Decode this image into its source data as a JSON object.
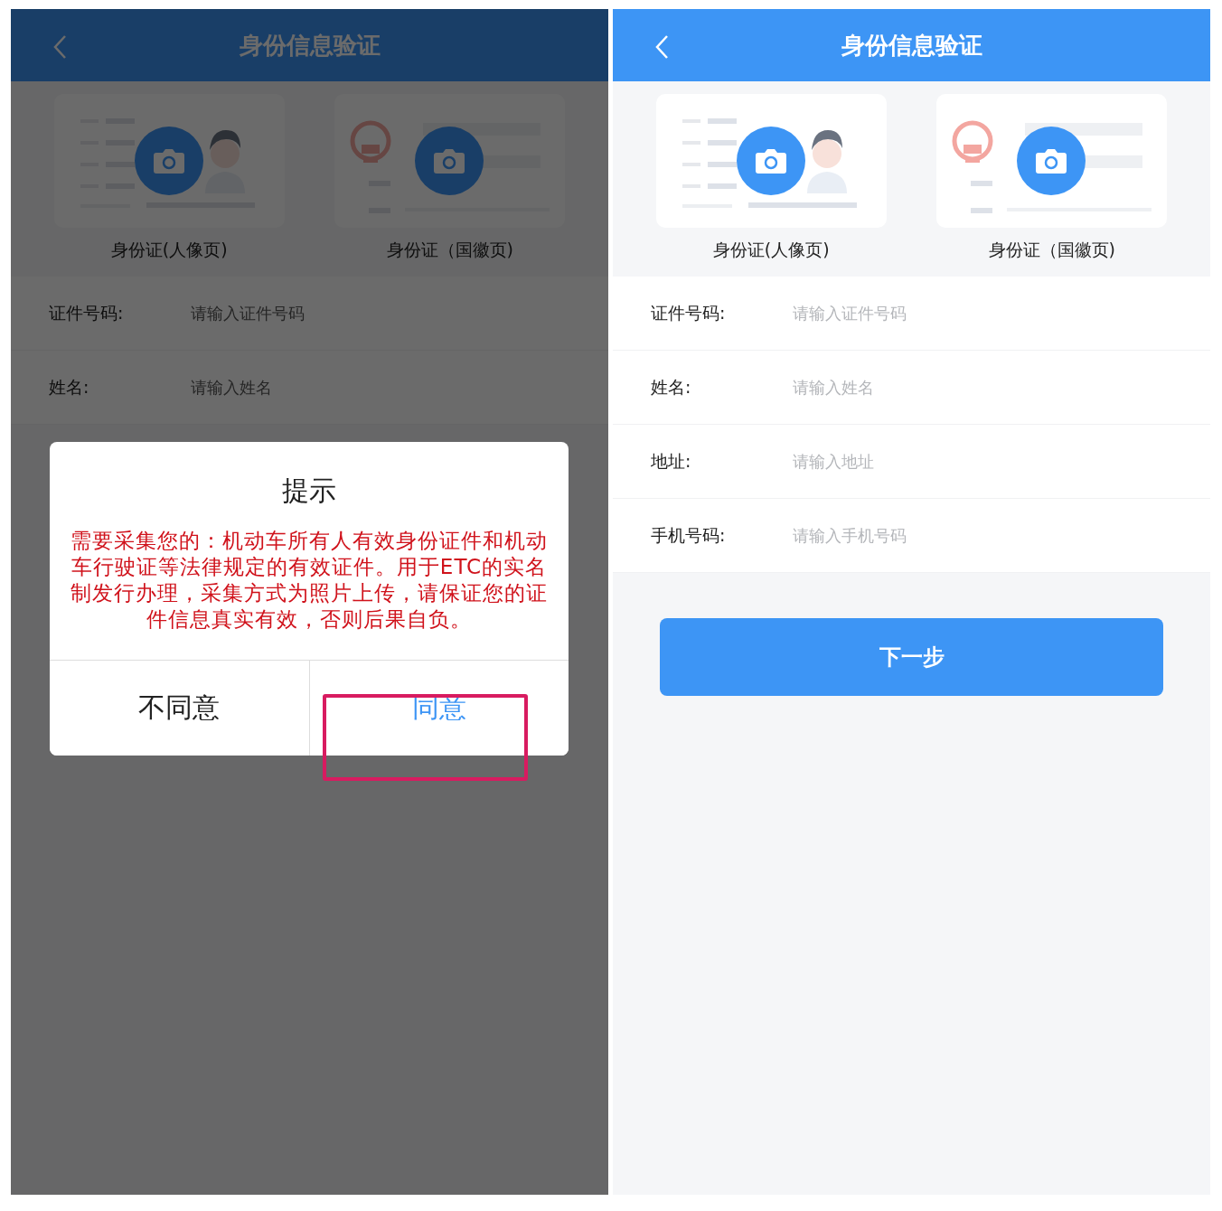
{
  "screens": [
    {
      "title": "身份信息验证",
      "dimmed": true,
      "id_cards": [
        {
          "kind": "portrait",
          "label": "身份证(人像页)"
        },
        {
          "kind": "emblem",
          "label": "身份证（国徽页)"
        }
      ],
      "fields": [
        {
          "label": "证件号码:",
          "placeholder": "请输入证件号码"
        },
        {
          "label": "姓名:",
          "placeholder": "请输入姓名"
        }
      ],
      "dialog": {
        "title": "提示",
        "message": "需要采集您的：机动车所有人有效身份证件和机动车行驶证等法律规定的有效证件。用于ETC的实名制发行办理，采集方式为照片上传，请保证您的证件信息真实有效，否则后果自负。",
        "buttons": [
          {
            "label": "不同意",
            "primary": false,
            "highlighted": false
          },
          {
            "label": "同意",
            "primary": true,
            "highlighted": true
          }
        ]
      }
    },
    {
      "title": "身份信息验证",
      "dimmed": false,
      "id_cards": [
        {
          "kind": "portrait",
          "label": "身份证(人像页)"
        },
        {
          "kind": "emblem",
          "label": "身份证（国徽页)"
        }
      ],
      "fields": [
        {
          "label": "证件号码:",
          "placeholder": "请输入证件号码"
        },
        {
          "label": "姓名:",
          "placeholder": "请输入姓名"
        },
        {
          "label": "地址:",
          "placeholder": "请输入地址"
        },
        {
          "label": "手机号码:",
          "placeholder": "请输入手机号码"
        }
      ],
      "next_button": "下一步"
    }
  ]
}
